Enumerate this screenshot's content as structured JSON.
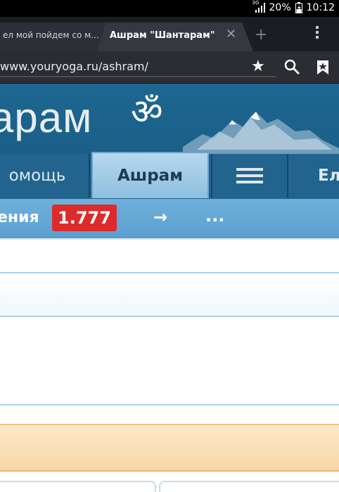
{
  "status_bar": {
    "network": "3G",
    "battery": "20%",
    "time": "10:12"
  },
  "browser": {
    "tabs": [
      {
        "label": "ел мой пойдем со м...",
        "active": false
      },
      {
        "label": "Ашрам \"Шантарам\"",
        "active": true
      }
    ],
    "url": "www.youryoga.ru/ashram/"
  },
  "site": {
    "logo_text": "арам",
    "nav": {
      "help_label": "омощь",
      "ashram_label": "Ашрам",
      "last_label": "Ел"
    },
    "notifications": {
      "label": "ения",
      "count": "1.777",
      "arrow": "→",
      "more": "..."
    }
  },
  "colors": {
    "header_bg": "#1b6390",
    "nav_active_bg": "#a8d0ea",
    "notif_bg": "#64a8d6",
    "badge_bg": "#dd2b2b",
    "highlight_row": "#fbe0b8"
  }
}
